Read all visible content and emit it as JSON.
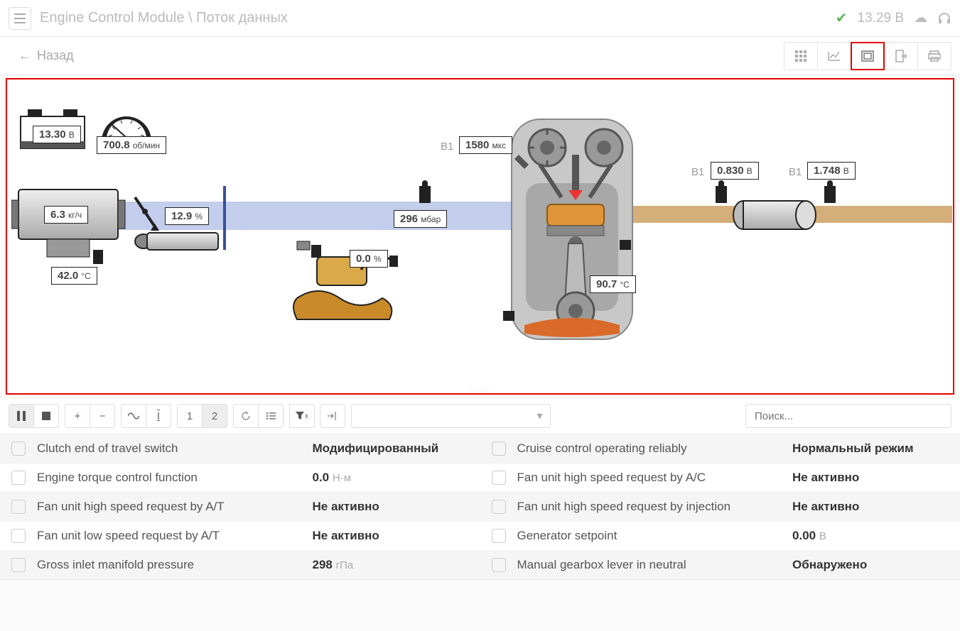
{
  "header": {
    "module": "Engine Control Module",
    "page": "Поток данных",
    "voltage": "13.29",
    "voltage_unit": "В"
  },
  "subbar": {
    "back": "Назад"
  },
  "diagram": {
    "battery": {
      "value": "13.30",
      "unit": "В"
    },
    "rpm": {
      "value": "700.8",
      "unit": "об/мин"
    },
    "maf": {
      "value": "6.3",
      "unit": "кг/ч"
    },
    "iat": {
      "value": "42.0",
      "unit": "°C"
    },
    "throttle": {
      "value": "12.9",
      "unit": "%"
    },
    "purge": {
      "value": "0.0",
      "unit": "%"
    },
    "map": {
      "value": "296",
      "unit": "мбар"
    },
    "inj": {
      "prefix": "B1",
      "value": "1580",
      "unit": "мкс"
    },
    "coolant": {
      "value": "90.7",
      "unit": "°C"
    },
    "o2_1": {
      "prefix": "B1",
      "value": "0.830",
      "unit": "В"
    },
    "o2_2": {
      "prefix": "B1",
      "value": "1.748",
      "unit": "В"
    }
  },
  "toolbar": {
    "page1": "1",
    "page2": "2",
    "search_placeholder": "Поиск..."
  },
  "grid": {
    "left": [
      {
        "name": "Clutch end of travel switch",
        "value": "Модифицированный",
        "unit": ""
      },
      {
        "name": "Engine torque control function",
        "value": "0.0",
        "unit": "Н·м"
      },
      {
        "name": "Fan unit high speed request by A/T",
        "value": "Не активно",
        "unit": ""
      },
      {
        "name": "Fan unit low speed request by A/T",
        "value": "Не активно",
        "unit": ""
      },
      {
        "name": "Gross inlet manifold pressure",
        "value": "298",
        "unit": "гПа"
      }
    ],
    "right": [
      {
        "name": "Cruise control operating reliably",
        "value": "Нормальный режим",
        "unit": ""
      },
      {
        "name": "Fan unit high speed request by A/C",
        "value": "Не активно",
        "unit": ""
      },
      {
        "name": "Fan unit high speed request by injection",
        "value": "Не активно",
        "unit": ""
      },
      {
        "name": "Generator setpoint",
        "value": "0.00",
        "unit": "В"
      },
      {
        "name": "Manual gearbox lever in neutral",
        "value": "Обнаружено",
        "unit": ""
      }
    ]
  }
}
